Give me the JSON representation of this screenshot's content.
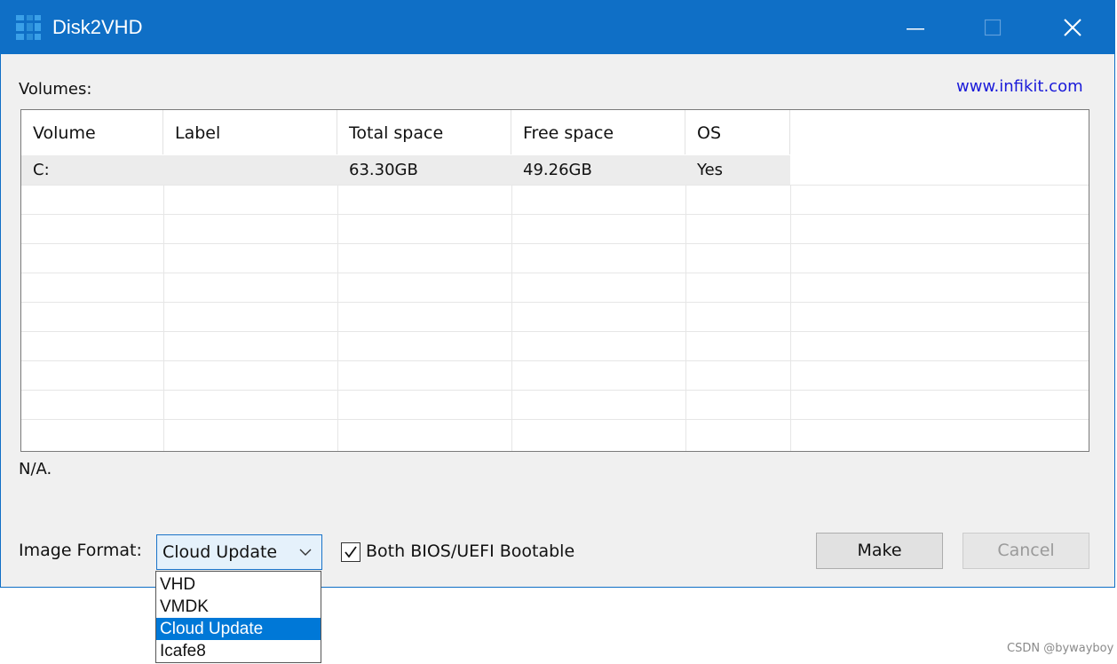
{
  "window": {
    "title": "Disk2VHD",
    "accent": "#0f6fc6",
    "controls": {
      "minimize": "minimize-icon",
      "maximize": "maximize-icon",
      "close": "close-icon"
    }
  },
  "volumes_label": "Volumes:",
  "website_link": "www.infikit.com",
  "table": {
    "columns": [
      "Volume",
      "Label",
      "Total space",
      "Free space",
      "OS"
    ],
    "rows": [
      {
        "volume": "C:",
        "label": "",
        "total_space": "63.30GB",
        "free_space": "49.26GB",
        "os": "Yes"
      }
    ]
  },
  "status_text": "N/A.",
  "image_format": {
    "label": "Image Format:",
    "selected": "Cloud Update",
    "options": [
      "VHD",
      "VMDK",
      "Cloud Update",
      "Icafe8"
    ]
  },
  "bootable_checkbox": {
    "label": "Both BIOS/UEFI Bootable",
    "checked": true
  },
  "buttons": {
    "make": "Make",
    "cancel": "Cancel"
  },
  "watermark": "CSDN @bywayboy"
}
